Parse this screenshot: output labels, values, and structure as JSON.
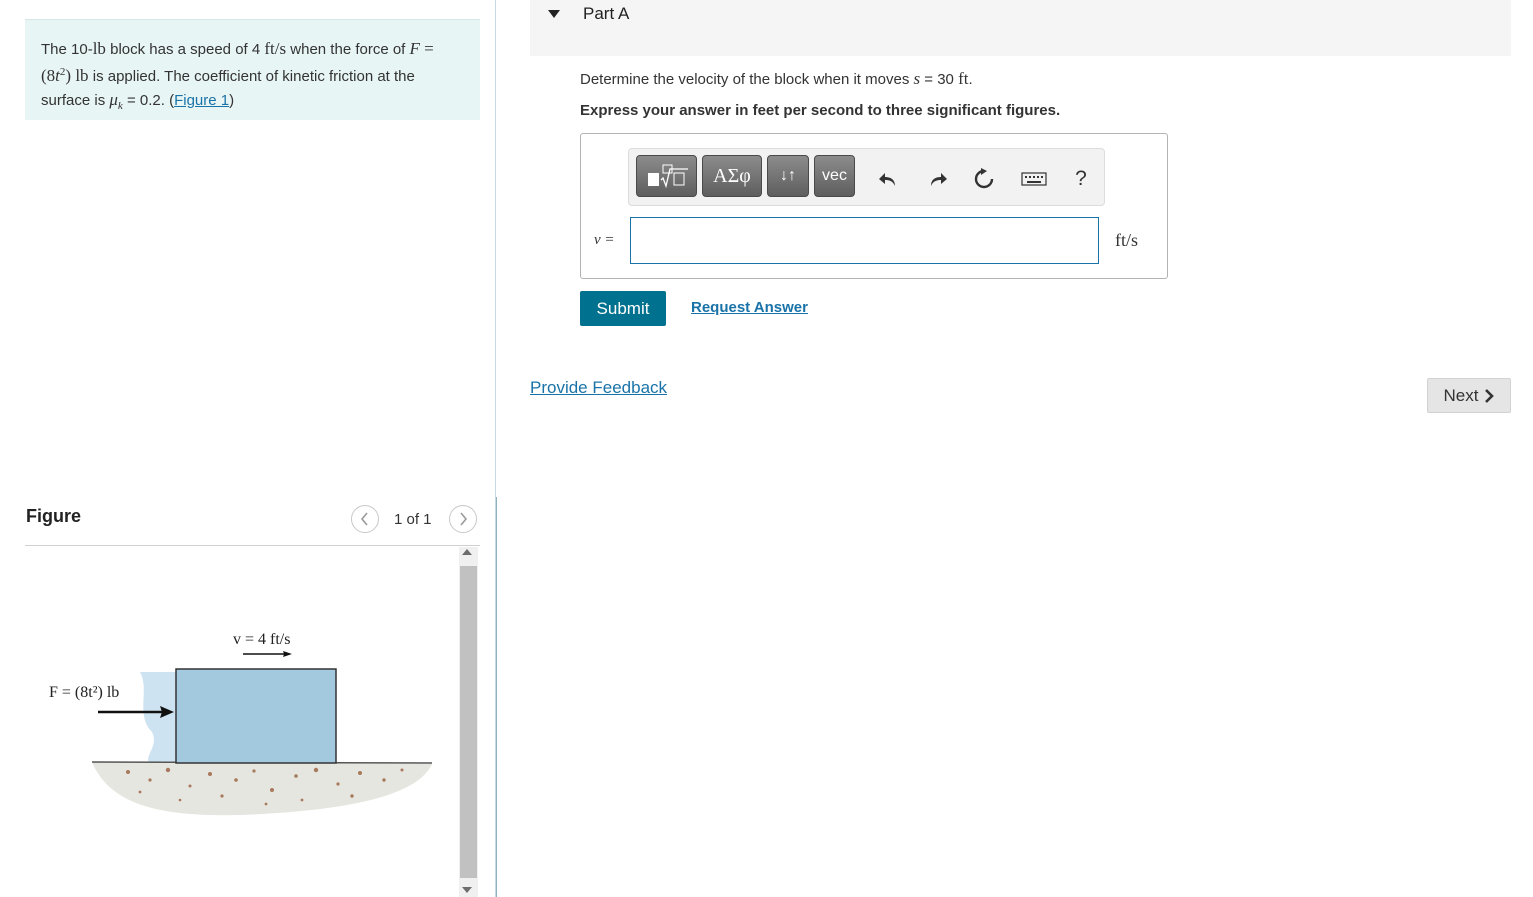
{
  "problem": {
    "t1": "The 10-",
    "m1": "lb",
    "t2": " block has a speed of 4 ",
    "m2": "ft/s",
    "t3": " when the force of ",
    "m3a": "F",
    "m3b": " = (8",
    "m3c": "t",
    "m3d": "2",
    "m3e": ") ",
    "m3f": "lb",
    "t4": " is applied. The coefficient of kinetic friction at the surface is ",
    "m4a": "μ",
    "m4b": "k",
    "t5": " = 0.2. (",
    "link": "Figure 1",
    "t6": ")"
  },
  "figure": {
    "title": "Figure",
    "counter": "1 of 1",
    "velocity_label": "v = 4 ft/s",
    "force_label": "F = (8t²) lb"
  },
  "part": {
    "title": "Part A",
    "q1": "Determine the velocity of the block when it moves ",
    "q_var": "s",
    "q2": " = 30 ",
    "q_unit": "ft",
    "q3": ".",
    "instruction": "Express your answer in feet per second to three significant figures."
  },
  "toolbar": {
    "greek_label": "ΑΣφ",
    "arrows_label": "↓↑",
    "vec_label": "vec",
    "help_label": "?"
  },
  "answer": {
    "variable_label": "v =",
    "value": "",
    "unit": "ft/s"
  },
  "actions": {
    "submit_label": "Submit",
    "request_answer_label": "Request Answer",
    "feedback_label": "Provide Feedback",
    "next_label": "Next"
  },
  "colors": {
    "accent": "#00718f",
    "link": "#1a73a8",
    "problem_bg": "#e8f5f5",
    "block_fill": "#a3c9df"
  }
}
